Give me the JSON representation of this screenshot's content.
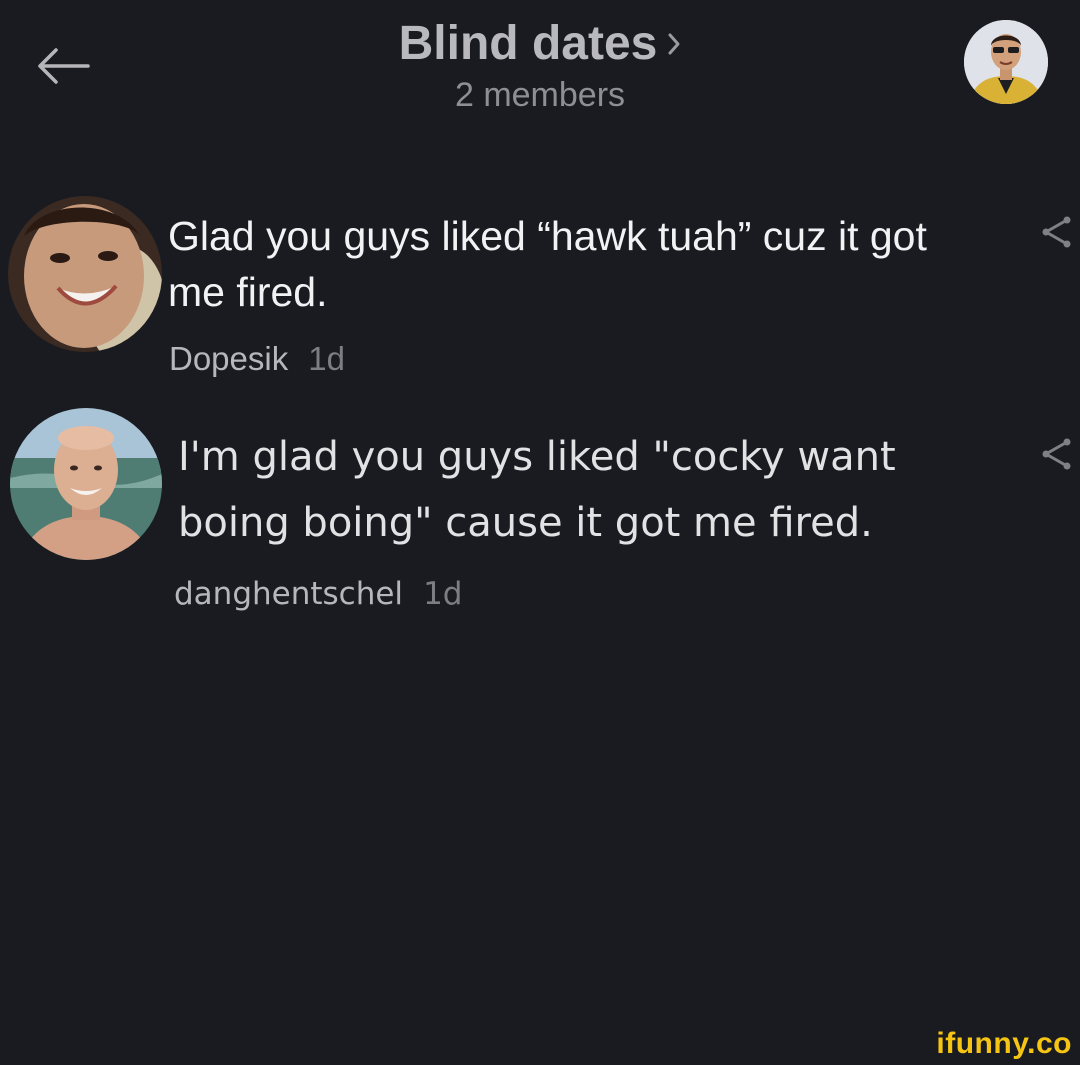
{
  "header": {
    "back_icon": "arrow-left-icon",
    "title": "Blind dates",
    "title_chevron_icon": "chevron-right-icon",
    "subtitle": "2 members",
    "avatar_icon": "avatar-icon"
  },
  "messages": [
    {
      "text": "Glad you guys liked “hawk tuah” cuz it got me fired.",
      "username": "Dopesik",
      "time": "1d",
      "share_icon": "share-icon"
    },
    {
      "text": "I'm glad you guys liked \"cocky want boing boing\" cause it got me fired.",
      "username": "danghentschel",
      "time": "1d",
      "share_icon": "share-icon"
    }
  ],
  "watermark": "ifunny.co",
  "colors": {
    "background": "#1a1b20",
    "title": "#b9b9bd",
    "message_text": "#f2f2f4",
    "meta_text": "#7d7d82",
    "watermark": "#f6c514"
  }
}
